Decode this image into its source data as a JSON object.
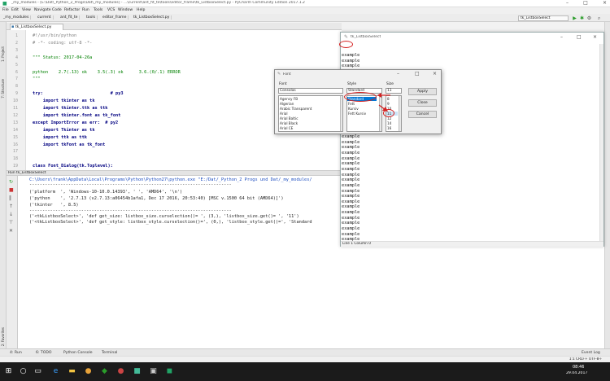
{
  "ide": {
    "title": "_my_modules - [E:\\Dat\\_Python_2_Progs\\Dat\\_my_modules] - ...\\current\\ant_fit_te\\tools\\editor_frame\\tk_ListboxSelect.py - PyCharm Community Edition 2017.1.2",
    "window_controls": [
      "–",
      "□",
      "×"
    ],
    "menu": [
      "File",
      "Edit",
      "View",
      "Navigate",
      "Code",
      "Refactor",
      "Run",
      "Tools",
      "VCS",
      "Window",
      "Help"
    ],
    "breadcrumbs": [
      "_my_modules",
      "current",
      "ant_fit_te",
      "tools",
      "editor_frame",
      "tk_ListboxSelect.py"
    ],
    "run_config": "tk_ListboxSelect",
    "left_tabs": [
      "1: Project",
      "7: Structure",
      "2: Favorites"
    ],
    "editor_tab": "tk_ListboxSelect.py",
    "line_numbers": [
      "1",
      "2",
      "3",
      "4",
      "5",
      "6",
      "7",
      "8",
      "9",
      "10",
      "11",
      "12",
      "13",
      "14",
      "15",
      "16",
      "17",
      "18",
      "19"
    ],
    "code_lines": [
      "#!/usr/bin/python",
      "# -*- coding: utf-8 -*-",
      "",
      "\"\"\" Status: 2017-04-26a",
      "",
      "python    2.7(.13) ok    3.5(.3) ok      3.6.(0/.1) ERROR",
      "\"\"\"",
      "",
      "try:                          # py3",
      "    import tkinter as tk",
      "    import tkinter.ttk as ttk",
      "    import tkinter.font as tk_font",
      "except ImportError as err:  # py2",
      "    import Tkinter as tk",
      "    import ttk as ttk",
      "    import tkFont as tk_font",
      "",
      "",
      "class Font_Dialog(tk.Toplevel):"
    ],
    "run_header": "Run  tk_ListboxSelect",
    "console_lines": [
      "C:\\Users\\frank\\AppData\\Local\\Programs\\Python\\Python27\\python.exe \"E:/Dat/_Python_2 Progs und Dat/_my_modules/",
      "------------------------------------------------------------------------------",
      "('platform  ', 'Windows-10-10.0.14393', ' ', 'AMD64', '\\n')",
      "('python    ', '2.7.13 (v2.7.13:a06454b1afa1, Dec 17 2016, 20:53:40) [MSC v.1500 64 bit (AMD64)]')",
      "('tkinter   ', 8.5)",
      "------------------------------------------------------------------------------",
      "('<tkListboxSelect>', 'def get_size: listbox_size.curselection()= ', (3,), 'listbox_size.get()= ', '11')",
      "('<tkListboxSelect>', 'def get_style: listbox_style.curselection()=', (0,), 'listbox_style.get()=', 'Standard"
    ],
    "bottom_tabs": [
      "4: Run",
      "6: TODO",
      "Python Console",
      "Terminal"
    ],
    "event_log": "Event Log",
    "status_right": "1:1   CRLF÷   UTF-8÷",
    "taskbar_time": "08:46",
    "taskbar_date": "29.04.2017"
  },
  "example_window": {
    "title": "tk_ListboxSelect",
    "lines": [
      "example",
      "example",
      "example",
      "example",
      "example",
      "example",
      "example",
      "example",
      "example",
      "example",
      "example",
      "example",
      "example",
      "example",
      "example",
      "example",
      "example",
      "example",
      "example",
      "example",
      "example",
      "example",
      "example",
      "example",
      "example",
      "example",
      "example",
      "example",
      "example",
      "example",
      "example",
      "example",
      "example",
      "example",
      "example",
      "example"
    ],
    "status": "Line 1   Column 0"
  },
  "font_dialog": {
    "title": "Font",
    "font_label": "Font",
    "font_value": "Consolas",
    "font_list": [
      "Agency FB",
      "Algerian",
      "Arabic Transparent",
      "Arial",
      "Arial Baltic",
      "Arial Black",
      "Arial CE"
    ],
    "style_label": "Style",
    "style_value": "Standard",
    "style_list": [
      "Standard",
      "Fett",
      "Kursiv",
      "Fett Kursiv"
    ],
    "size_label": "Size",
    "size_value": "11",
    "size_list": [
      "8",
      "9",
      "10",
      "11",
      "12",
      "14",
      "16"
    ],
    "buttons": [
      "Apply",
      "Close",
      "Cancel"
    ]
  },
  "colors": {
    "keyword": "#000080",
    "comment": "#808080",
    "string": "#008000",
    "annotation": "#d42020",
    "selection": "#0078d7"
  }
}
